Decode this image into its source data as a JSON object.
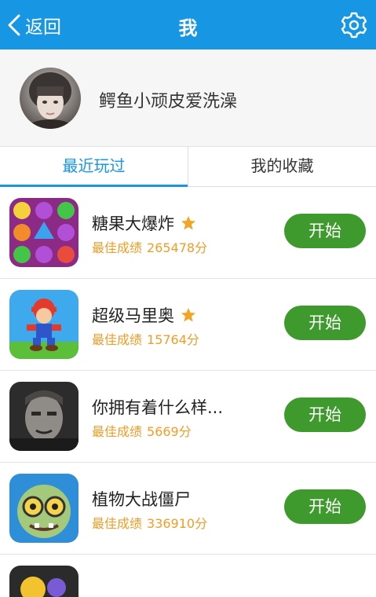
{
  "header": {
    "back_label": "返回",
    "title": "我",
    "accent": "#1796e3"
  },
  "profile": {
    "username": "鳄鱼小顽皮爱洗澡"
  },
  "tabs": [
    {
      "label": "最近玩过",
      "active": true
    },
    {
      "label": "我的收藏",
      "active": false
    }
  ],
  "games": [
    {
      "name": "糖果大爆炸",
      "starred": true,
      "score_label": "最佳成绩",
      "score": "265478分",
      "button": "开始"
    },
    {
      "name": "超级马里奥",
      "starred": true,
      "score_label": "最佳成绩",
      "score": "15764分",
      "button": "开始"
    },
    {
      "name": "你拥有着什么样...",
      "starred": false,
      "score_label": "最佳成绩",
      "score": "5669分",
      "button": "开始"
    },
    {
      "name": "植物大战僵尸",
      "starred": false,
      "score_label": "最佳成绩",
      "score": "336910分",
      "button": "开始"
    }
  ],
  "colors": {
    "button": "#3f9a2d",
    "score": "#f39c26",
    "star": "#f2a627"
  }
}
